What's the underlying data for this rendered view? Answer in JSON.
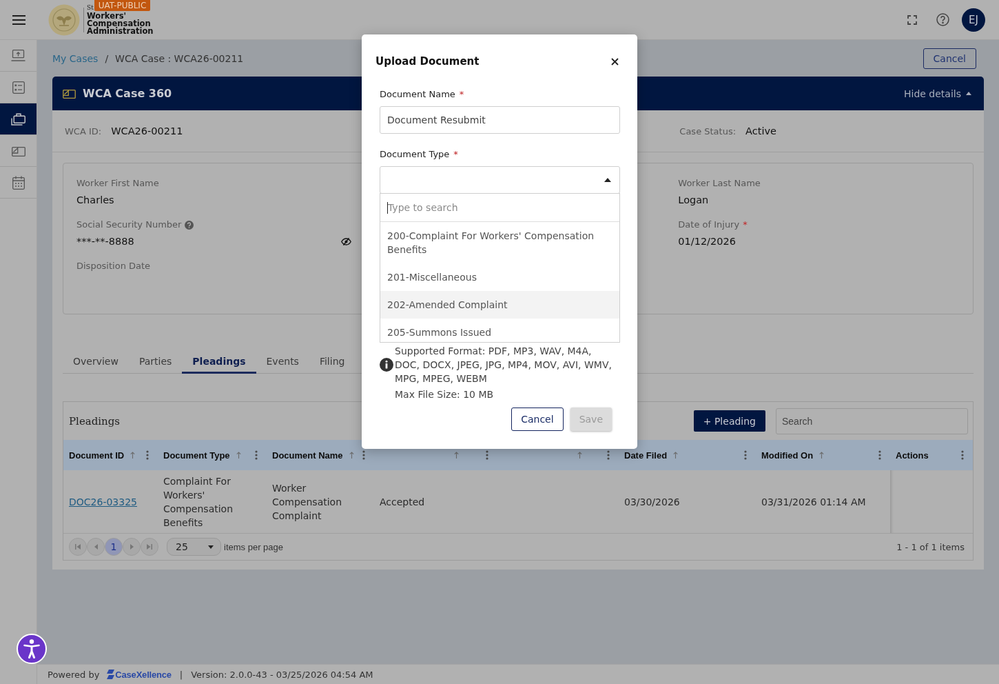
{
  "header": {
    "logo_small_text": "St",
    "badge": "UAT-PUBLIC",
    "logo_lines": [
      "Workers'",
      "Compensation",
      "Administration"
    ],
    "avatar_initials": "EJ"
  },
  "sidebar": {
    "items": [
      {
        "kind": "upload",
        "selected": false
      },
      {
        "kind": "checklist",
        "selected": false
      },
      {
        "kind": "briefcase",
        "selected": true
      },
      {
        "kind": "card",
        "selected": false
      },
      {
        "kind": "calendar",
        "selected": false
      }
    ]
  },
  "breadcrumb": {
    "link": "My Cases",
    "separator": "/",
    "current": "WCA Case : WCA26-00211"
  },
  "cancel_button": {
    "label": "Cancel"
  },
  "case": {
    "title": "WCA Case 360",
    "toggle": {
      "label": "Hide details",
      "expanded": true
    },
    "summary": {
      "left": {
        "label": "WCA ID:",
        "value": "WCA26-00211"
      },
      "right": {
        "label": "Case Status:",
        "value": "Active"
      }
    },
    "details": {
      "left_column": [
        {
          "label": "Worker First Name",
          "help": false,
          "value": "Charles"
        },
        {
          "label": "Social Security Number",
          "help": true,
          "value": "***-**-8888",
          "masked": true
        },
        {
          "label": "Disposition Date",
          "help": false
        }
      ],
      "right_column": [
        {
          "label": "Worker Last Name",
          "help": false,
          "value": "Logan"
        },
        {
          "label": "Date of Injury",
          "required_mark": "*",
          "help": false,
          "value": "01/12/2026"
        }
      ]
    }
  },
  "tabs": [
    {
      "label": "Overview",
      "selected": false
    },
    {
      "label": "Parties",
      "selected": false
    },
    {
      "label": "Pleadings",
      "selected": true
    },
    {
      "label": "Events",
      "selected": false
    },
    {
      "label": "Filing",
      "selected": false
    }
  ],
  "pleadings": {
    "title": "Pleadings",
    "add_button": "+ Pleading",
    "search": {
      "placeholder": "Search"
    },
    "table": {
      "columns": [
        {
          "label": "Document ID",
          "sortable": true
        },
        {
          "label": "Document Type",
          "sortable": true
        },
        {
          "label": "Document Name",
          "sortable": true
        },
        {
          "sortable": true
        },
        {
          "sortable": true
        },
        {
          "label": "Date Filed",
          "sortable": true
        },
        {
          "label": "Modified On",
          "sortable": true
        },
        {
          "label": "Actions",
          "sortable": false
        }
      ],
      "rows": [
        {
          "document_id": "DOC26-03325",
          "document_type": "Complaint For Workers' Compensation Benefits",
          "document_name": "Worker Compensation Complaint",
          "document_status": "Accepted",
          "date_filed": "03/30/2026",
          "modified_on": "03/31/2026 01:14 AM"
        }
      ]
    },
    "pager": {
      "pages": [
        {
          "label": "1",
          "selected": true
        }
      ],
      "page_size": "25",
      "page_size_label": "items per page",
      "summary": "1 - 1 of 1 items"
    }
  },
  "footer": {
    "powered_by": "Powered by",
    "brand": "CaseXellence",
    "separator": "|",
    "version": "Version: 2.0.0-43 - 03/25/2026 04:54 AM"
  },
  "modal": {
    "title": "Upload Document",
    "fields": [
      {
        "kind": "text",
        "label": "Document Name",
        "required_mark": "*",
        "value": "Document Resubmit"
      },
      {
        "kind": "select",
        "label": "Document Type",
        "required_mark": "*",
        "expanded": true,
        "search": {
          "placeholder": "Type to search",
          "focused": true
        },
        "options": [
          {
            "label": "200-Complaint For Workers' Compensation Benefits",
            "highlighted": false
          },
          {
            "label": "201-Miscellaneous",
            "highlighted": false
          },
          {
            "label": "202-Amended Complaint",
            "highlighted": true
          },
          {
            "label": "205-Summons Issued",
            "highlighted": false
          }
        ]
      }
    ],
    "info": {
      "formats_lines": [
        "Supported Format: PDF, MP3, WAV, M4A,",
        "DOC, DOCX, JPEG, JPG, MP4, MOV, AVI, WMV,",
        "MPG, MPEG, WEBM"
      ],
      "max_size": "Max File Size: 10 MB"
    },
    "buttons": [
      {
        "label": "Cancel",
        "kind": "secondary",
        "disabled": false
      },
      {
        "label": "Save",
        "kind": "primary",
        "disabled": true
      }
    ]
  }
}
